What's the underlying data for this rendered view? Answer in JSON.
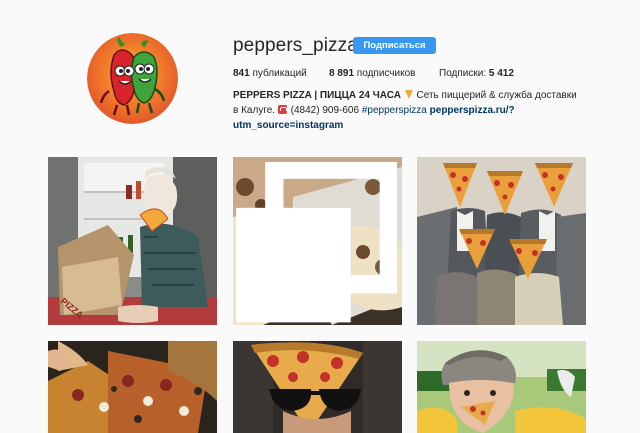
{
  "profile": {
    "username": "peppers_pizza",
    "follow_label": "Подписаться",
    "avatar_icon": "chili-peppers-logo-icon"
  },
  "stats": {
    "posts_count": "841",
    "posts_label": " публикаций",
    "followers_count": "8 891",
    "followers_label": " подписчиков",
    "following_label": "Подписки: ",
    "following_count": "5 412"
  },
  "bio": {
    "name": "PEPPERS PIZZA | ПИЦЦА 24 ЧАСА",
    "text_1": " Сеть пиццерий & служба доставки в Калуге.",
    "phone": " (4842) 909-606 ",
    "hashtag": "#pepperspizza",
    "link": " pepperspizza.ru/?utm_source=instagram"
  },
  "posts": [
    {
      "icon": "photo-woman-fridge-pizza"
    },
    {
      "icon": "photo-pizza-box-closeup",
      "multi": "multiple-photos-icon"
    },
    {
      "icon": "photo-men-pizza-heads"
    },
    {
      "icon": "photo-pizza-slices-hands"
    },
    {
      "icon": "photo-pizza-sunglasses"
    },
    {
      "icon": "photo-child-eating-pizza"
    }
  ],
  "colors": {
    "accent": "#3897f0",
    "link": "#003569",
    "avatar_bg": "#ea5a26"
  }
}
